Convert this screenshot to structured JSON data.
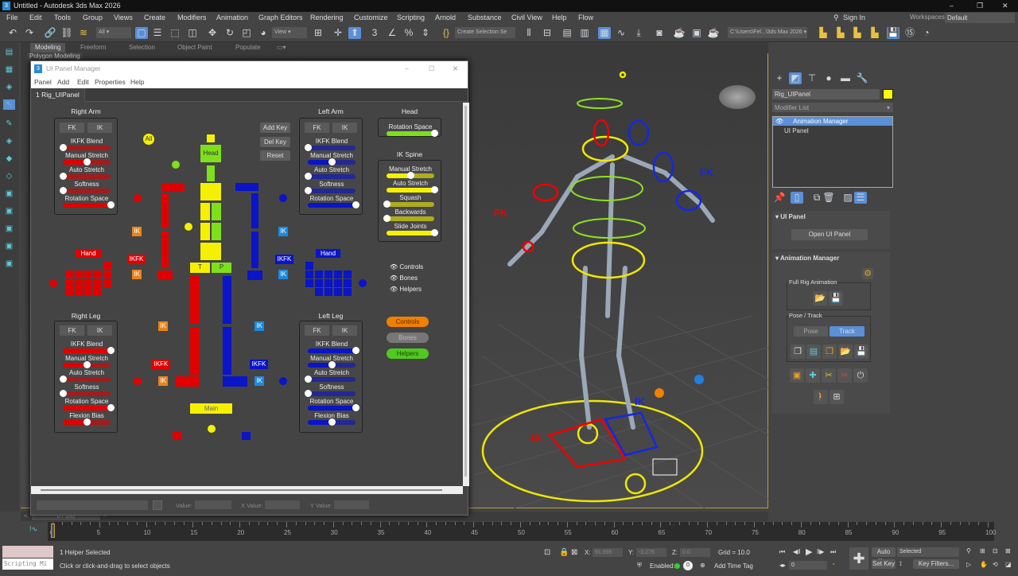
{
  "window": {
    "title": "Untitled - Autodesk 3ds Max 2026",
    "minimize": "–",
    "restore": "❐",
    "close": "✕"
  },
  "menu": [
    "File",
    "Edit",
    "Tools",
    "Group",
    "Views",
    "Create",
    "Modifiers",
    "Animation",
    "Graph Editors",
    "Rendering",
    "Customize",
    "Scripting",
    "Arnold",
    "Substance",
    "Civil View",
    "Help",
    "Flow"
  ],
  "account": {
    "sign_in": "Sign In",
    "workspaces_label": "Workspaces:",
    "workspace": "Default"
  },
  "toolbar": {
    "filter": "All",
    "ref_coord": "View",
    "selection_set": "Create Selection Se",
    "project_path": "C:\\Users\\Fel...\\3ds Max 2026"
  },
  "ribbon": {
    "tabs": [
      "Modeling",
      "Freeform",
      "Selection",
      "Object Paint",
      "Populate"
    ],
    "sub": "Polygon Modeling"
  },
  "dialog": {
    "title": "UI Panel Manager",
    "menu": [
      "Panel",
      "Add",
      "Edit",
      "Properties",
      "Help"
    ],
    "tab": "1 Rig_UIPanel",
    "groups": {
      "right_arm": {
        "title": "Right Arm",
        "fk": "FK",
        "ik": "IK",
        "color": "#e00000",
        "sliders": [
          {
            "label": "IKFK Blend",
            "value": 0
          },
          {
            "label": "Manual Stretch",
            "value": 0.5
          },
          {
            "label": "Auto Stretch",
            "value": 0
          },
          {
            "label": "Softness",
            "value": 0
          },
          {
            "label": "Rotation Space",
            "value": 1
          }
        ]
      },
      "left_arm": {
        "title": "Left Arm",
        "fk": "FK",
        "ik": "IK",
        "color": "#0a14c8",
        "sliders": [
          {
            "label": "IKFK Blend",
            "value": 0
          },
          {
            "label": "Manual Stretch",
            "value": 0.5
          },
          {
            "label": "Auto Stretch",
            "value": 0
          },
          {
            "label": "Softness",
            "value": 0
          },
          {
            "label": "Rotation Space",
            "value": 1
          }
        ]
      },
      "head": {
        "title": "Head",
        "color": "#7ee01a",
        "sliders": [
          {
            "label": "Rotation Space",
            "value": 1
          }
        ]
      },
      "ik_spine": {
        "title": "IK Spine",
        "color": "#f5f000",
        "sliders": [
          {
            "label": "Manual Stretch",
            "value": 0.5
          },
          {
            "label": "Auto Stretch",
            "value": 1
          },
          {
            "label": "Squash",
            "value": 0
          },
          {
            "label": "Backwards",
            "value": 0
          },
          {
            "label": "Slide Joints",
            "value": 1
          }
        ]
      },
      "right_leg": {
        "title": "Right Leg",
        "fk": "FK",
        "ik": "IK",
        "color": "#e00000",
        "sliders": [
          {
            "label": "IKFK Blend",
            "value": 1
          },
          {
            "label": "Manual Stretch",
            "value": 0.5
          },
          {
            "label": "Auto Stretch",
            "value": 0
          },
          {
            "label": "Softness",
            "value": 0
          },
          {
            "label": "Rotation Space",
            "value": 1
          },
          {
            "label": "Flexion Bias",
            "value": 0.5
          }
        ]
      },
      "left_leg": {
        "title": "Left Leg",
        "fk": "FK",
        "ik": "IK",
        "color": "#0a14c8",
        "sliders": [
          {
            "label": "IKFK Blend",
            "value": 1
          },
          {
            "label": "Manual Stretch",
            "value": 0.5
          },
          {
            "label": "Auto Stretch",
            "value": 0
          },
          {
            "label": "Softness",
            "value": 0
          },
          {
            "label": "Rotation Space",
            "value": 1
          },
          {
            "label": "Flexion Bias",
            "value": 0.5
          }
        ]
      }
    },
    "key_buttons": {
      "add": "Add Key",
      "del": "Del Key",
      "reset": "Reset"
    },
    "visibility": [
      "Controls",
      "Bones",
      "Helpers"
    ],
    "pills": {
      "controls": "Controls",
      "bones": "Bones",
      "helpers": "Helpers"
    },
    "picker": {
      "all": "All",
      "head": "Head",
      "t": "T",
      "p": "P",
      "main": "Main",
      "hand_r": "Hand",
      "hand_l": "Hand",
      "ik": "IK",
      "ikfk": "IKFK"
    },
    "footer": {
      "value_label": "Value:",
      "x_value_label": "X Value:",
      "y_value_label": "Y Value:"
    }
  },
  "viewport": {
    "labels": {
      "fk_red": "FK",
      "fk_blue": "FK",
      "ik_red": "IK",
      "ik_blue": "IK"
    }
  },
  "command_panel": {
    "object_name": "Rig_UIPanel",
    "object_color": "#ffff00",
    "modifier_list": "Modifier List",
    "stack": [
      "Animation Manager",
      "UI Panel"
    ],
    "rollouts": {
      "ui_panel": "UI Panel",
      "open_ui_panel": "Open UI Panel",
      "anim_manager": "Animation Manager",
      "full_rig": "Full Rig Animation",
      "pose_track": "Pose / Track",
      "pose": "Pose",
      "track": "Track"
    }
  },
  "timeline": {
    "range": "0 / 100",
    "prev": "<",
    "next": ">",
    "current_frame": 0,
    "ticks": [
      0,
      5,
      10,
      15,
      20,
      25,
      30,
      35,
      40,
      45,
      50,
      55,
      60,
      65,
      70,
      75,
      80,
      85,
      90,
      95,
      100
    ]
  },
  "status": {
    "listener": "Scripting Mi",
    "selection": "1 Helper Selected",
    "prompt": "Click or click-and-drag to select objects",
    "x_label": "X:",
    "x": "91.695",
    "y_label": "Y:",
    "y": "-3.276",
    "z_label": "Z:",
    "z": "0.0",
    "grid": "Grid = 10.0",
    "enabled": "Enabled:",
    "time_tag_count": "0",
    "add_time_tag": "Add Time Tag",
    "frame": "0",
    "auto_key": "Auto Key",
    "set_key": "Set Key",
    "key_mode": "Selected",
    "key_filters": "Key Filters..."
  }
}
